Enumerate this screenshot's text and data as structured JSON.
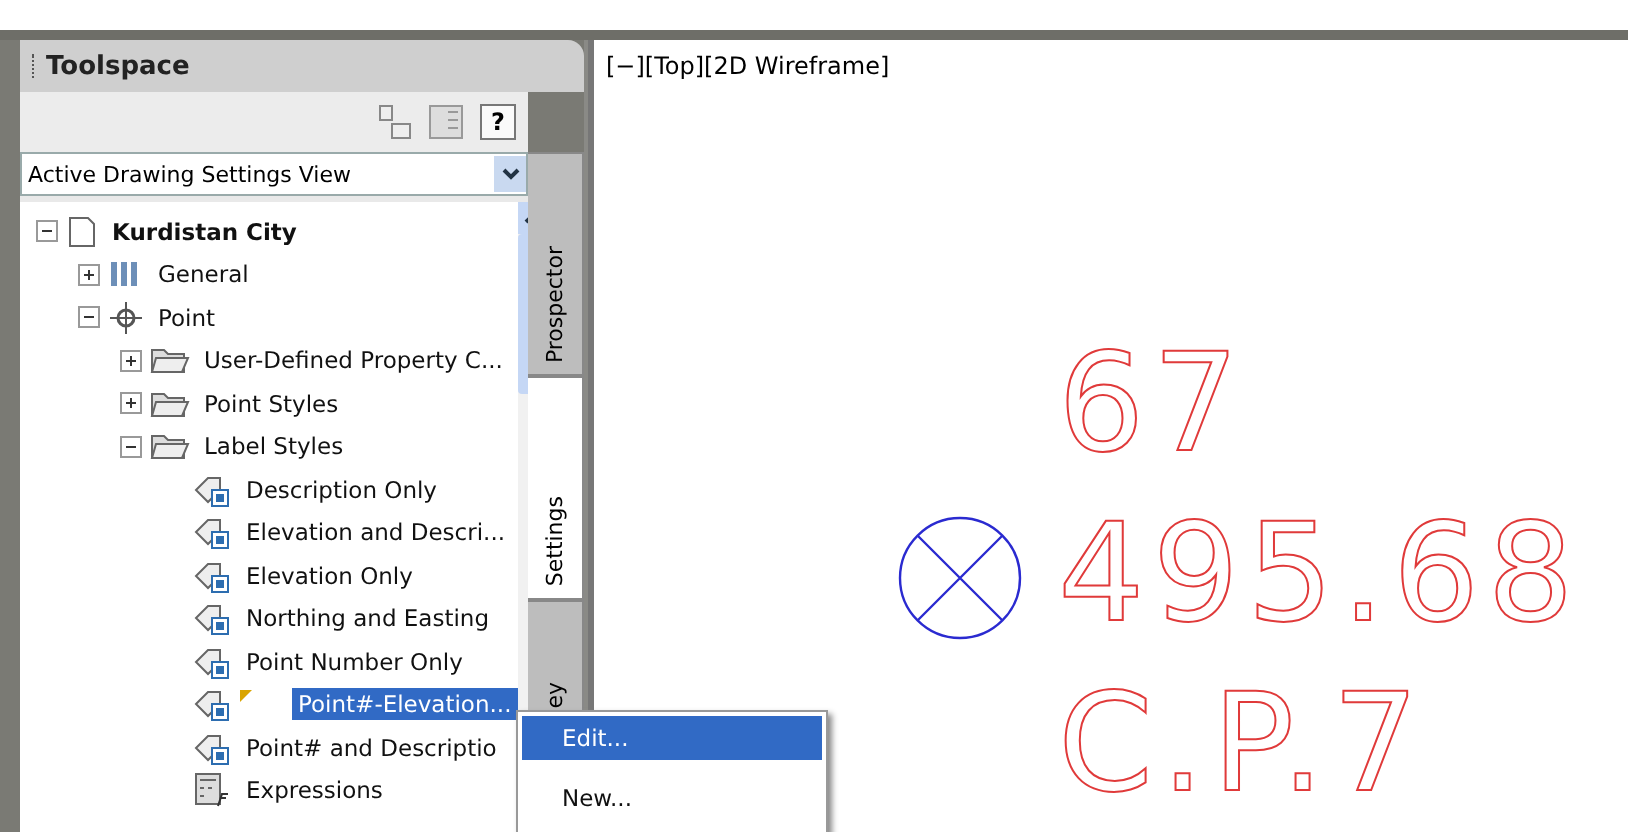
{
  "toolspace": {
    "title": "Toolspace",
    "help_label": "?",
    "view_dropdown": {
      "value": "Active Drawing Settings View"
    },
    "tabs": [
      {
        "label": "Prospector",
        "selected": false
      },
      {
        "label": "Settings",
        "selected": true
      },
      {
        "label": "ey",
        "selected": false
      }
    ],
    "tree": [
      {
        "label": "Kurdistan City",
        "kind": "drawing",
        "expanded": true,
        "selected": false,
        "children": [
          {
            "label": "General",
            "kind": "general",
            "expanded": false,
            "selected": false
          },
          {
            "label": "Point",
            "kind": "point",
            "expanded": true,
            "selected": false,
            "children": [
              {
                "label": "User-Defined Property C...",
                "kind": "folder",
                "expanded": false,
                "selected": false
              },
              {
                "label": "Point Styles",
                "kind": "folder",
                "expanded": false,
                "selected": false
              },
              {
                "label": "Label Styles",
                "kind": "folder",
                "expanded": true,
                "selected": false,
                "children": [
                  {
                    "label": "Description Only",
                    "kind": "style",
                    "selected": false
                  },
                  {
                    "label": "Elevation and Descri...",
                    "kind": "style",
                    "selected": false
                  },
                  {
                    "label": "Elevation Only",
                    "kind": "style",
                    "selected": false
                  },
                  {
                    "label": "Northing and Easting",
                    "kind": "style",
                    "selected": false
                  },
                  {
                    "label": "Point Number Only",
                    "kind": "style",
                    "selected": false
                  },
                  {
                    "label": "Point#-Elevation...",
                    "kind": "style",
                    "selected": true,
                    "current": true
                  },
                  {
                    "label": "Point# and Descriptio",
                    "kind": "style",
                    "selected": false
                  },
                  {
                    "label": "Expressions",
                    "kind": "expressions",
                    "selected": false
                  }
                ]
              }
            ]
          }
        ]
      }
    ]
  },
  "viewport": {
    "label": "[−][Top][2D Wireframe]",
    "point_label": [
      "67",
      "495.68",
      "C.P.7"
    ]
  },
  "context_menu": [
    {
      "label": "Edit...",
      "selected": true
    },
    {
      "label": "New...",
      "selected": false
    }
  ]
}
